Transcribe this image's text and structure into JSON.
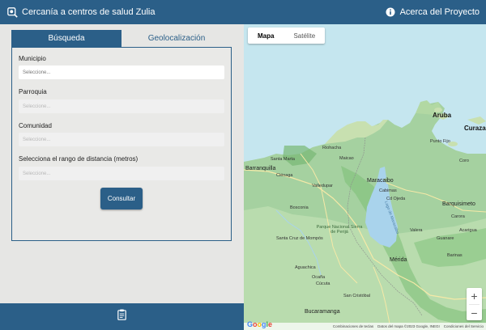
{
  "header": {
    "title": "Cercanía a centros de salud Zulia",
    "about_label": "Acerca del Proyecto"
  },
  "tabs": [
    {
      "label": "Búsqueda",
      "active": true
    },
    {
      "label": "Geolocalización",
      "active": false
    }
  ],
  "form": {
    "municipio_label": "Municipio",
    "municipio_placeholder": "Seleccione...",
    "parroquia_label": "Parroquia",
    "parroquia_placeholder": "Seleccione...",
    "comunidad_label": "Comunidad",
    "comunidad_placeholder": "Seleccione...",
    "distancia_label": "Selecciona el rango de distancia (metros)",
    "distancia_placeholder": "Seleccione...",
    "submit_label": "Consultar"
  },
  "map": {
    "type_buttons": [
      "Mapa",
      "Satélite"
    ],
    "zoom_in": "+",
    "zoom_out": "−",
    "google_logo": "Google",
    "attribution": {
      "shortcuts": "Combinaciones de teclas",
      "data": "Datos del mapa ©2023 Google, INEGI",
      "terms": "Condiciones del Servicio"
    },
    "places": {
      "aruba": "Aruba",
      "curazao": "Curaza",
      "barranquilla": "Barranquilla",
      "santa_marta": "Santa Marta",
      "cienaga": "Ciénaga",
      "riohacha": "Riohacha",
      "maicao": "Maicao",
      "punto_fijo": "Punto Fijo",
      "maracaibo": "Maracaibo",
      "cabimas": "Cabimas",
      "ciudad_ojeda": "Cd Ojeda",
      "valledupar": "Valledupar",
      "coro": "Coro",
      "barquisimeto": "Barquisimeto",
      "carora": "Carora",
      "bosconia": "Bosconia",
      "mompos": "Santa Cruz de Mompós",
      "parque": "Parque Nacional Sierra de Perijá",
      "merida": "Mérida",
      "barinas": "Barinas",
      "cucuta": "Cúcuta",
      "san_cristobal": "San Cristóbal",
      "bucaramanga": "Bucaramanga",
      "aguachica": "Aguachica",
      "ocana": "Ocaña",
      "lake": "Lago de Maracaibo",
      "guanare": "Guanare",
      "valera": "Valera",
      "acarigua": "Acarigua"
    }
  }
}
